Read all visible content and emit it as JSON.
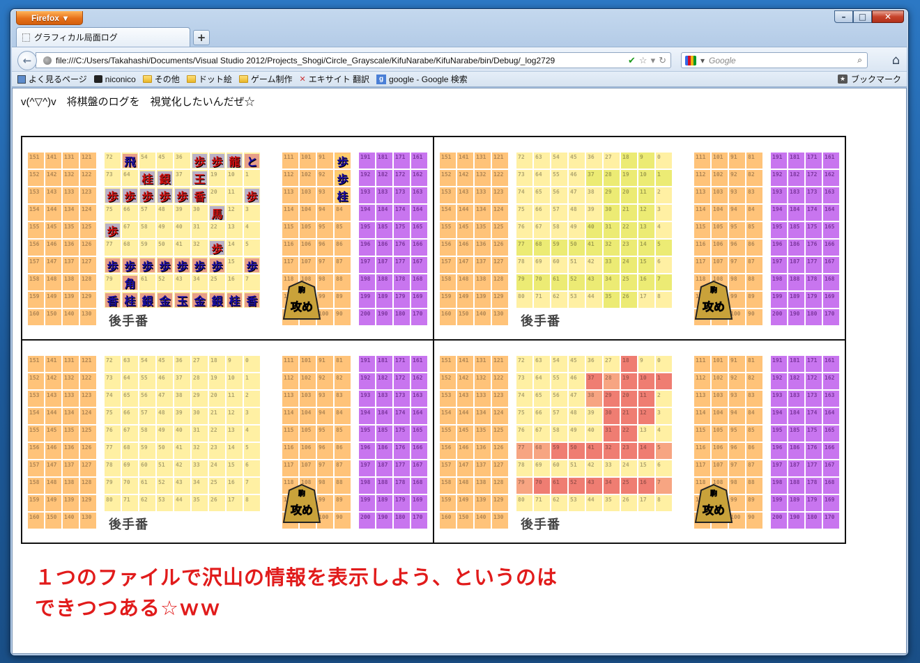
{
  "window": {
    "app_button": "Firefox",
    "tab_title": "グラフィカル局面ログ",
    "url": "file:///C:/Users/Takahashi/Documents/Visual Studio 2012/Projects_Shogi/Circle_Grayscale/KifuNarabe/KifuNarabe/bin/Debug/_log2729",
    "search_placeholder": "Google",
    "bookmarks": [
      "よく見るページ",
      "niconico",
      "その他",
      "ドット絵",
      "ゲーム制作",
      "エキサイト 翻訳",
      "google - Google 検索"
    ],
    "bookmarks_menu": "ブックマーク"
  },
  "page": {
    "heading": "v(^▽^)v　将棋盤のログを　視覚化したいんだぜ☆",
    "turn_label": "後手番",
    "badge_top": "駒",
    "badge_text": "攻め",
    "note_line1": "１つのファイルで沢山の情報を表示しよう、というのは",
    "note_line2": "できつつある☆ｗｗ"
  },
  "grid_numbers": {
    "left_block": [
      [
        "151",
        "141",
        "131",
        "121"
      ],
      [
        "152",
        "142",
        "132",
        "122"
      ],
      [
        "153",
        "143",
        "133",
        "123"
      ],
      [
        "154",
        "144",
        "134",
        "124"
      ],
      [
        "155",
        "145",
        "135",
        "125"
      ],
      [
        "156",
        "146",
        "136",
        "126"
      ],
      [
        "157",
        "147",
        "137",
        "127"
      ],
      [
        "158",
        "148",
        "138",
        "128"
      ],
      [
        "159",
        "149",
        "139",
        "129"
      ],
      [
        "160",
        "150",
        "140",
        "130"
      ]
    ],
    "board": [
      [
        "72",
        "63",
        "54",
        "45",
        "36",
        "27",
        "18",
        "9",
        "0"
      ],
      [
        "73",
        "64",
        "55",
        "46",
        "37",
        "28",
        "19",
        "10",
        "1"
      ],
      [
        "74",
        "65",
        "56",
        "47",
        "38",
        "29",
        "20",
        "11",
        "2"
      ],
      [
        "75",
        "66",
        "57",
        "48",
        "39",
        "30",
        "21",
        "12",
        "3"
      ],
      [
        "76",
        "67",
        "58",
        "49",
        "40",
        "31",
        "22",
        "13",
        "4"
      ],
      [
        "77",
        "68",
        "59",
        "50",
        "41",
        "32",
        "23",
        "14",
        "5"
      ],
      [
        "78",
        "69",
        "60",
        "51",
        "42",
        "33",
        "24",
        "15",
        "6"
      ],
      [
        "79",
        "70",
        "61",
        "52",
        "43",
        "34",
        "25",
        "16",
        "7"
      ],
      [
        "80",
        "71",
        "62",
        "53",
        "44",
        "35",
        "26",
        "17",
        "8"
      ]
    ],
    "right_block": [
      [
        "111",
        "101",
        "91",
        "81"
      ],
      [
        "112",
        "102",
        "92",
        "82"
      ],
      [
        "113",
        "103",
        "93",
        "83"
      ],
      [
        "114",
        "104",
        "94",
        "84"
      ],
      [
        "115",
        "105",
        "95",
        "85"
      ],
      [
        "116",
        "106",
        "96",
        "86"
      ],
      [
        "117",
        "107",
        "97",
        "87"
      ],
      [
        "118",
        "108",
        "98",
        "88"
      ],
      [
        "119",
        "109",
        "99",
        "89"
      ],
      [
        "120",
        "110",
        "100",
        "90"
      ]
    ],
    "purple_block": [
      [
        "191",
        "181",
        "171",
        "161"
      ],
      [
        "192",
        "182",
        "172",
        "162"
      ],
      [
        "193",
        "183",
        "173",
        "163"
      ],
      [
        "194",
        "184",
        "174",
        "164"
      ],
      [
        "195",
        "185",
        "175",
        "165"
      ],
      [
        "196",
        "186",
        "176",
        "166"
      ],
      [
        "197",
        "187",
        "177",
        "167"
      ],
      [
        "198",
        "188",
        "178",
        "168"
      ],
      [
        "199",
        "189",
        "179",
        "169"
      ],
      [
        "200",
        "190",
        "180",
        "170"
      ]
    ]
  },
  "pieces_panel1": {
    "board": [
      [
        "",
        "飛",
        "",
        "",
        "",
        "歩",
        "歩",
        "",
        "と"
      ],
      [
        "",
        "",
        "",
        "",
        "",
        "",
        "",
        "",
        ""
      ],
      [
        "",
        "",
        "",
        "",
        "",
        "",
        "",
        "",
        ""
      ],
      [
        "",
        "",
        "",
        "",
        "",
        "",
        "",
        "",
        ""
      ],
      [
        "",
        "",
        "",
        "",
        "",
        "",
        "",
        "",
        ""
      ],
      [
        "",
        "",
        "",
        "",
        "",
        "",
        "",
        "",
        ""
      ],
      [
        "歩",
        "歩",
        "歩",
        "歩",
        "歩",
        "歩",
        "歩",
        "",
        "歩"
      ],
      [
        "",
        "角",
        "",
        "",
        "",
        "",
        "",
        "",
        ""
      ],
      [
        "香",
        "桂",
        "銀",
        "金",
        "玉",
        "金",
        "銀",
        "桂",
        "香"
      ]
    ],
    "gote": [
      [
        "",
        "",
        "",
        "",
        "",
        "歩",
        "歩",
        "龍",
        ""
      ],
      [
        "",
        "",
        "桂",
        "銀",
        "",
        "王",
        "",
        "",
        ""
      ],
      [
        "歩",
        "歩",
        "歩",
        "歩",
        "歩",
        "香",
        "",
        "",
        "歩"
      ],
      [
        "",
        "",
        "",
        "",
        "",
        "",
        "馬",
        "",
        ""
      ],
      [
        "歩",
        "",
        "",
        "",
        "",
        "",
        "",
        "",
        ""
      ],
      [
        "",
        "",
        "",
        "",
        "",
        "",
        "歩",
        "",
        ""
      ]
    ],
    "captured": [
      "歩",
      "歩",
      "桂"
    ]
  },
  "colors": {
    "orange": "#ffc379",
    "board": "#fff0a3",
    "purple": "#c875ef",
    "highlight_yellow": "#eceb74",
    "highlight_red": "#ef7d72",
    "note_red": "#e11b1b"
  }
}
